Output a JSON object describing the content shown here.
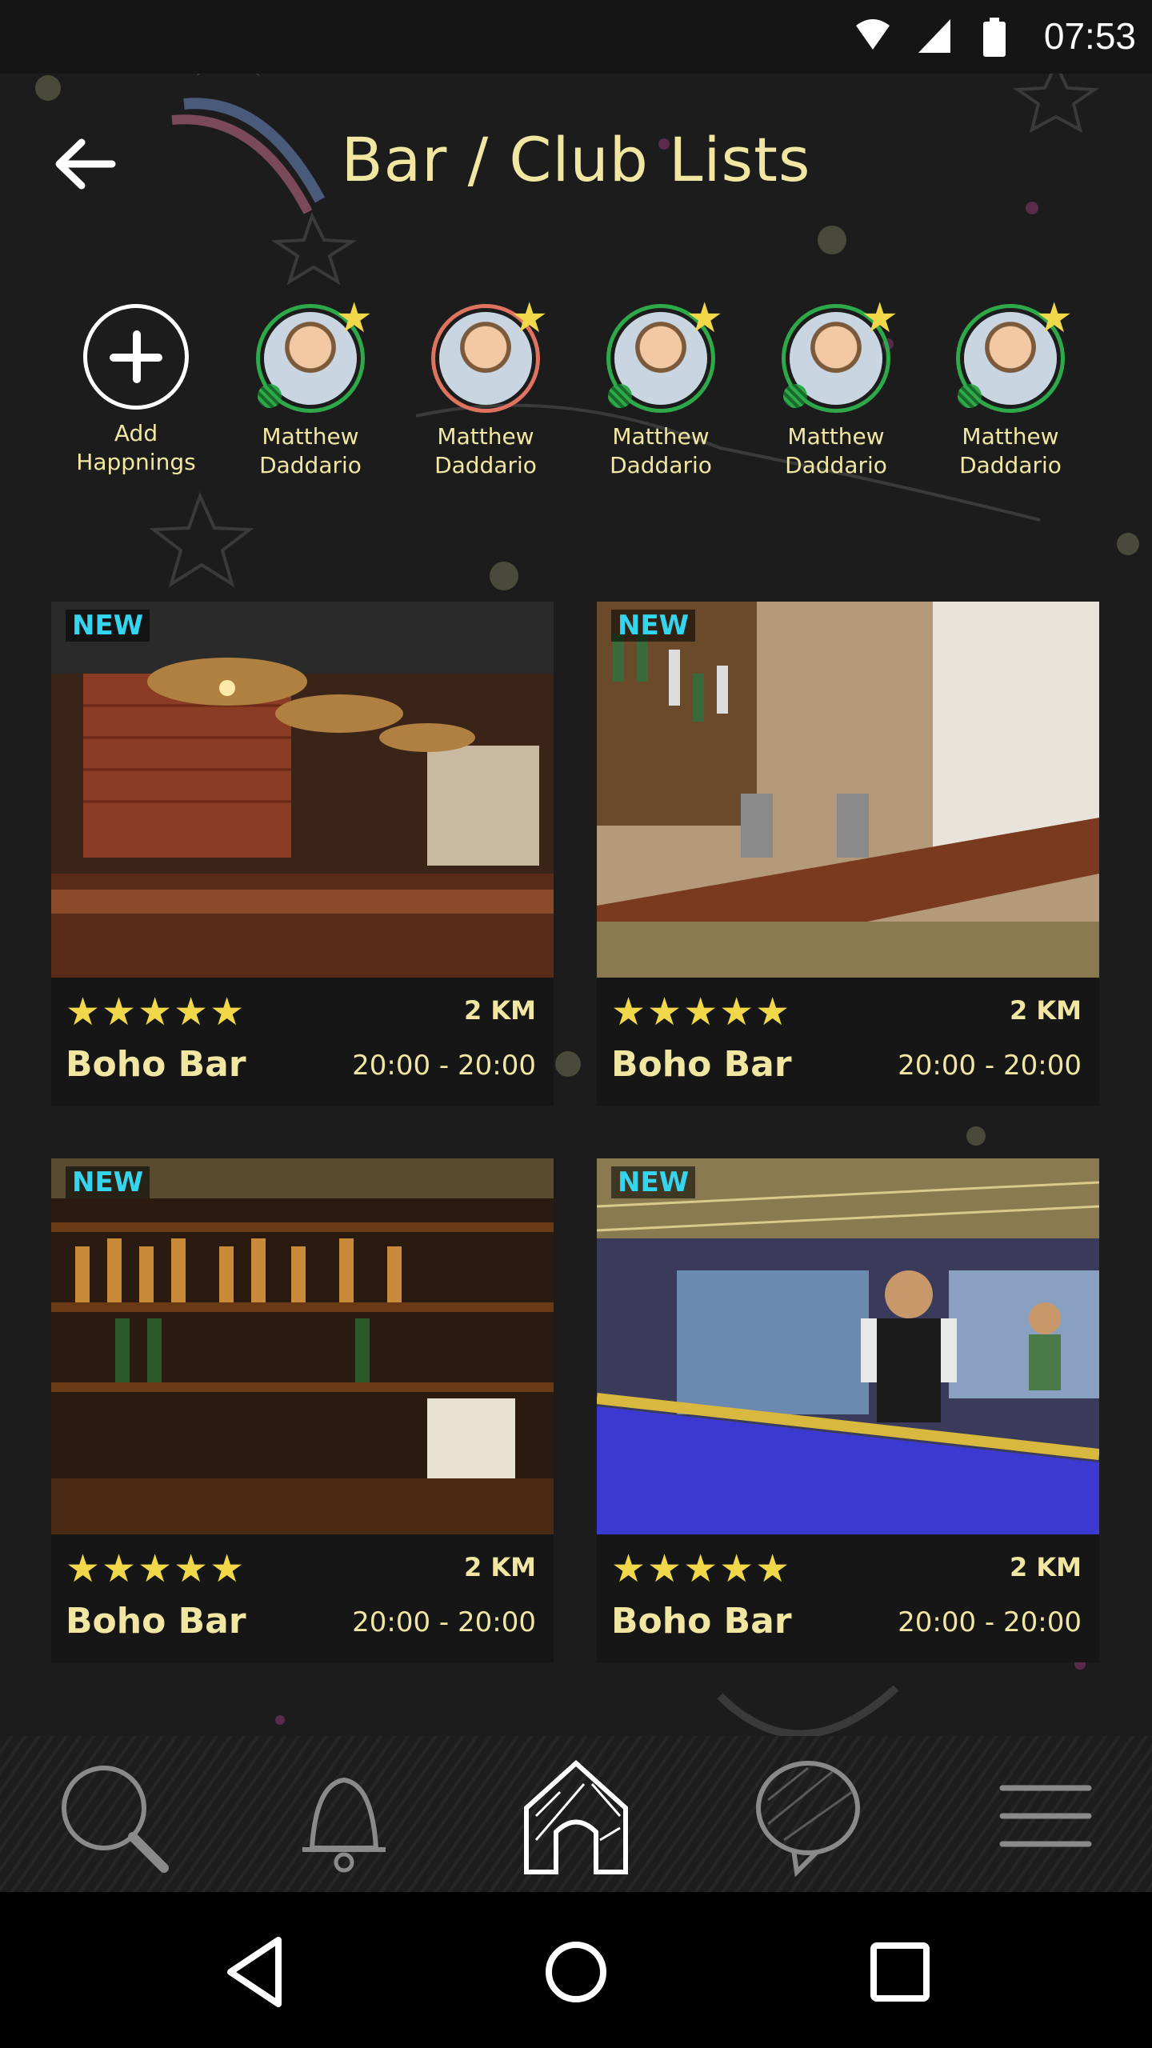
{
  "status_bar": {
    "time": "07:53",
    "icons": [
      "wifi-icon",
      "signal-icon",
      "battery-icon"
    ]
  },
  "header": {
    "title": "Bar / Club  Lists",
    "back_icon": "arrow-left-icon"
  },
  "stories": [
    {
      "label_line1": "Add",
      "label_line2": "Happnings",
      "type": "add"
    },
    {
      "label_line1": "Matthew",
      "label_line2": "Daddario",
      "ring_color": "#2ea94a"
    },
    {
      "label_line1": "Matthew",
      "label_line2": "Daddario",
      "ring_color": "#e0735f"
    },
    {
      "label_line1": "Matthew",
      "label_line2": "Daddario",
      "ring_color": "#2ea94a"
    },
    {
      "label_line1": "Matthew",
      "label_line2": "Daddario",
      "ring_color": "#2ea94a"
    },
    {
      "label_line1": "Matthew",
      "label_line2": "Daddario",
      "ring_color": "#2ea94a"
    }
  ],
  "cards": [
    {
      "badge": "NEW",
      "stars": "★★★★★",
      "distance": "2 KM",
      "name": "Boho Bar",
      "hours": "20:00 - 20:00"
    },
    {
      "badge": "NEW",
      "stars": "★★★★★",
      "distance": "2 KM",
      "name": "Boho Bar",
      "hours": "20:00 - 20:00"
    },
    {
      "badge": "NEW",
      "stars": "★★★★★",
      "distance": "2 KM",
      "name": "Boho Bar",
      "hours": "20:00 - 20:00"
    },
    {
      "badge": "NEW",
      "stars": "★★★★★",
      "distance": "2 KM",
      "name": "Boho Bar",
      "hours": "20:00 - 20:00"
    }
  ],
  "rating": 5,
  "bottom_nav": {
    "items": [
      "search-icon",
      "bell-icon",
      "home-icon",
      "chat-icon",
      "menu-icon"
    ],
    "active": "home-icon"
  },
  "system_nav": {
    "items": [
      "back-triangle-icon",
      "home-circle-icon",
      "recents-square-icon"
    ]
  },
  "colors": {
    "accent_text": "#f1e7a2",
    "new_badge": "#36d5ef",
    "star": "#f1d84b",
    "background": "#1c1c1c"
  }
}
